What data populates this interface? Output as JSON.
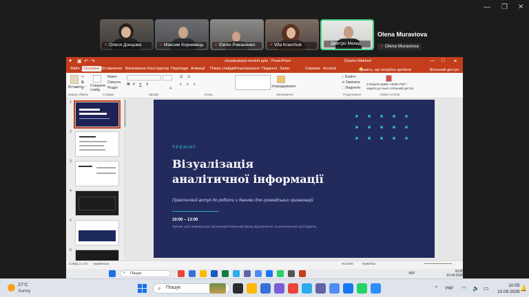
{
  "meeting": {
    "participants": [
      {
        "name": "Олеся Донцова"
      },
      {
        "name": "Максим Корневець"
      },
      {
        "name": "Євген Романенко"
      },
      {
        "name": "Vita Kravchuk"
      },
      {
        "name": "Дмитро Мехед"
      }
    ],
    "speaker_name": "Olena Muraviova",
    "self_label": "Olena Muraviova"
  },
  "ppt": {
    "window_title": "vizualizatsiya-treninh.pptx  ·  PowerPoint",
    "user": "Dmytro Mekhed",
    "tabs": [
      "Файл",
      "Основне",
      "Вставлення",
      "Малювання",
      "Конструктор",
      "Переходи",
      "Анімації",
      "Показ слайдів",
      "Рецензування",
      "Подання",
      "Запис",
      "Справка",
      "Acrobat"
    ],
    "active_tab": "Основне",
    "tell_me": "Скажіть, що потрібно зробити",
    "share": "Спільний доступ",
    "ribbon": {
      "paste": "Вставити",
      "new_slide": "Створити слайд",
      "layout": "Макет",
      "reset": "Скинути",
      "section": "Розділ",
      "arrange": "Упорядкування",
      "find": "Знайти",
      "replace": "Замінити",
      "select": "Виділити",
      "adobe": "Створити файл Adobe PDF і надати до нього спільний доступ",
      "groups": [
        "Буфер обміну",
        "Слайди",
        "Шрифт",
        "Абзац",
        "Малювання",
        "Редагування",
        "Adobe Acrobat"
      ]
    },
    "slide": {
      "kicker": "ТРЕНІНГ",
      "title_line1": "Візуалізація",
      "title_line2": "аналітичної інформації",
      "subtitle": "Практичний вступ до роботи з даними для громадських організацій",
      "time": "10:00 – 13:00",
      "description": "Тренінг для громадських організацій Київський фонд відновлення та регіональних досліджень"
    },
    "thumbnail_numbers": [
      "1",
      "2",
      "3",
      "4",
      "5",
      "6"
    ],
    "status": {
      "slide": "Слайд 1 з 23",
      "language": "українська",
      "notes": "Нотатки",
      "comments": "Примітки"
    }
  },
  "inner_taskbar": {
    "search": "Пошук",
    "lang": "УКР",
    "time": "10:05",
    "date": "10.09.2026"
  },
  "taskbar": {
    "weather_temp": "27°C",
    "weather_desc": "Sunny",
    "search": "Пошук",
    "lang": "УКР",
    "time": "10:05",
    "date": "10.09.2026",
    "colors": {
      "ppt_accent": "#c43e1c",
      "slide_bg": "#232a5c",
      "slide_accent": "#2fa8c9"
    }
  }
}
